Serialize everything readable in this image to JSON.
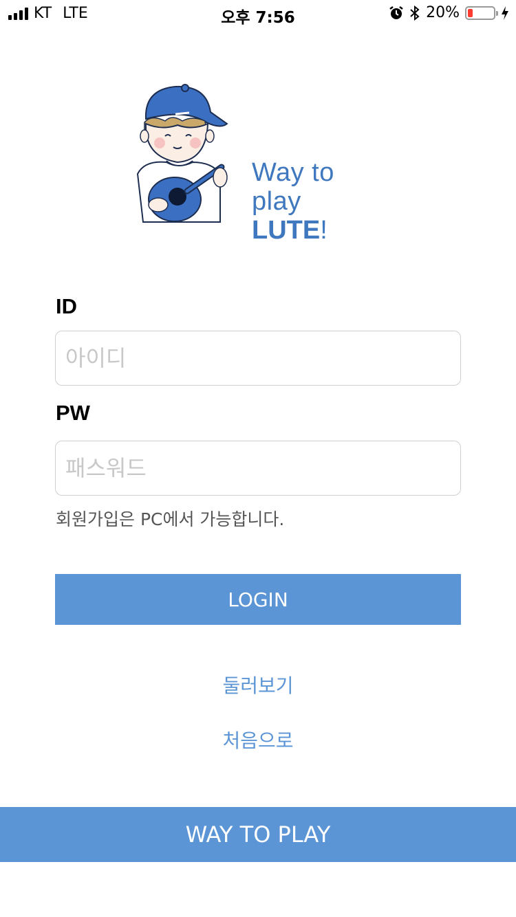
{
  "status_bar": {
    "carrier": "KT",
    "network": "LTE",
    "time": "오후 7:56",
    "battery_text": "20%",
    "battery_level": 0.2,
    "battery_color": "#ff3b30",
    "icons": [
      "signal-icon",
      "alarm-icon",
      "bluetooth-icon",
      "battery-icon",
      "charging-icon"
    ]
  },
  "logo": {
    "line1": "Way to play",
    "line2": "LUTE",
    "line2_suffix": "!",
    "color": "#3f78be"
  },
  "form": {
    "id_label": "ID",
    "id_placeholder": "아이디",
    "pw_label": "PW",
    "pw_placeholder": "패스워드",
    "signup_note": "회원가입은 PC에서 가능합니다."
  },
  "actions": {
    "login_label": "LOGIN",
    "browse_label": "둘러보기",
    "home_label": "처음으로"
  },
  "footer": {
    "label": "WAY TO PLAY"
  },
  "colors": {
    "accent": "#5b95d5",
    "text": "#000000",
    "placeholder": "#c8c8c8"
  }
}
